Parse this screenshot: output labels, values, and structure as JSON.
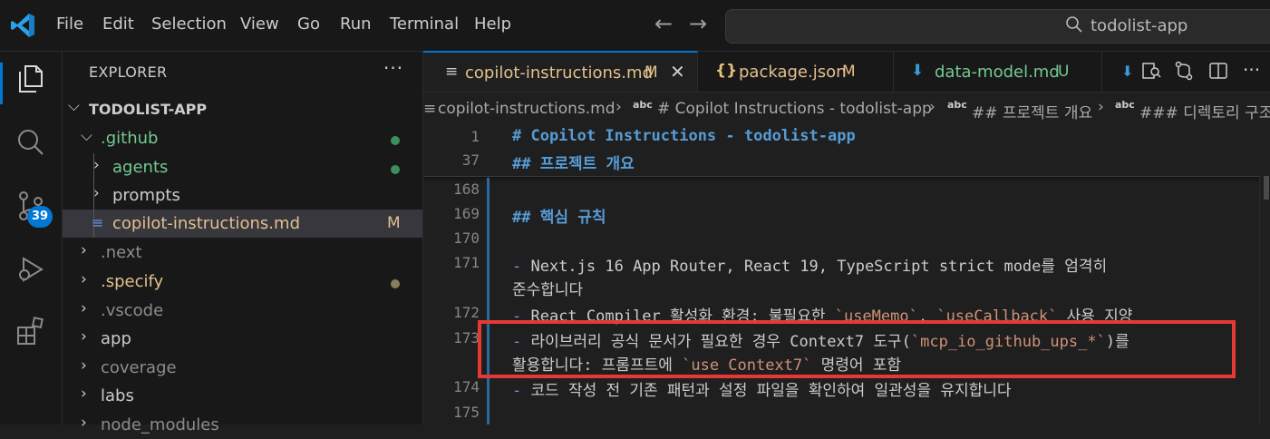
{
  "colors": {
    "accent": "#0078d4",
    "modified": "#e2c08d",
    "untracked_green": "#73c991",
    "highlight_red": "#e53935"
  },
  "menu": [
    "File",
    "Edit",
    "Selection",
    "View",
    "Go",
    "Run",
    "Terminal",
    "Help"
  ],
  "search": {
    "text": "todolist-app",
    "icon": "search-icon"
  },
  "activity": {
    "icons": [
      "explorer-icon",
      "search-icon",
      "source-control-icon",
      "run-debug-icon",
      "extensions-icon"
    ],
    "scm_badge": "39"
  },
  "explorer": {
    "title": "EXPLORER",
    "more": "···",
    "root": "TODOLIST-APP",
    "items": [
      {
        "label": ".github",
        "chevron": "⌵",
        "status": "dot-green"
      },
      {
        "label": "agents",
        "chevron": "›",
        "status": "dot-green"
      },
      {
        "label": "prompts",
        "chevron": "›",
        "status": ""
      },
      {
        "label": "copilot-instructions.md",
        "chevron": "",
        "status": "M"
      },
      {
        "label": ".next",
        "chevron": "›",
        "status": ""
      },
      {
        "label": ".specify",
        "chevron": "›",
        "status": "dot-tan"
      },
      {
        "label": ".vscode",
        "chevron": "›",
        "status": ""
      },
      {
        "label": "app",
        "chevron": "›",
        "status": ""
      },
      {
        "label": "coverage",
        "chevron": "›",
        "status": ""
      },
      {
        "label": "labs",
        "chevron": "›",
        "status": ""
      },
      {
        "label": "node_modules",
        "chevron": "›",
        "status": ""
      }
    ]
  },
  "tabs": [
    {
      "icon": "≡",
      "label": "copilot-instructions.md",
      "status": "M",
      "close": "✕"
    },
    {
      "icon": "{}",
      "label": "package.json",
      "status": "M"
    },
    {
      "icon": "⬇",
      "label": "data-model.md",
      "status": "U"
    }
  ],
  "breadcrumb": {
    "file": "copilot-instructions.md",
    "abc": "abc",
    "sections": [
      "# Copilot Instructions - todolist-app",
      "## 프로젝트 개요",
      "### 디렉토리 구조"
    ]
  },
  "editor": {
    "sticky": [
      {
        "ln": "1",
        "text": "# Copilot Instructions - todolist-app"
      },
      {
        "ln": "37",
        "text": "## 프로젝트 개요"
      }
    ],
    "lines": [
      {
        "ln": "168",
        "parts": []
      },
      {
        "ln": "169",
        "parts": [
          {
            "t": "## 핵심 규칙",
            "c": "h"
          }
        ]
      },
      {
        "ln": "170",
        "parts": []
      },
      {
        "ln": "171",
        "parts": [
          {
            "t": "- ",
            "c": "bul"
          },
          {
            "t": "Next.js 16 App Router, React 19, TypeScript strict mode를 엄격히",
            "c": ""
          }
        ]
      },
      {
        "ln": "",
        "parts": [
          {
            "t": "준수합니다",
            "c": ""
          }
        ]
      },
      {
        "ln": "172",
        "parts": [
          {
            "t": "- ",
            "c": "bul"
          },
          {
            "t": "React Compiler 활성화 환경: 불필요한 ",
            "c": ""
          },
          {
            "t": "`useMemo`",
            "c": "inl"
          },
          {
            "t": ", ",
            "c": ""
          },
          {
            "t": "`useCallback`",
            "c": "inl"
          },
          {
            "t": " 사용 지양",
            "c": ""
          }
        ]
      },
      {
        "ln": "173",
        "parts": [
          {
            "t": "- ",
            "c": "bul"
          },
          {
            "t": "라이브러리 공식 문서가 필요한 경우 Context7 도구(",
            "c": ""
          },
          {
            "t": "`mcp_io_github_ups_*`",
            "c": "inl"
          },
          {
            "t": ")를",
            "c": ""
          }
        ]
      },
      {
        "ln": "",
        "parts": [
          {
            "t": "활용합니다: 프롬프트에 ",
            "c": ""
          },
          {
            "t": "`use Context7`",
            "c": "inl"
          },
          {
            "t": " 명령어 포함",
            "c": ""
          }
        ]
      },
      {
        "ln": "174",
        "parts": [
          {
            "t": "- ",
            "c": "bul"
          },
          {
            "t": "코드 작성 전 기존 패턴과 설정 파일을 확인하여 일관성을 유지합니다",
            "c": ""
          }
        ]
      },
      {
        "ln": "175",
        "parts": []
      }
    ]
  }
}
